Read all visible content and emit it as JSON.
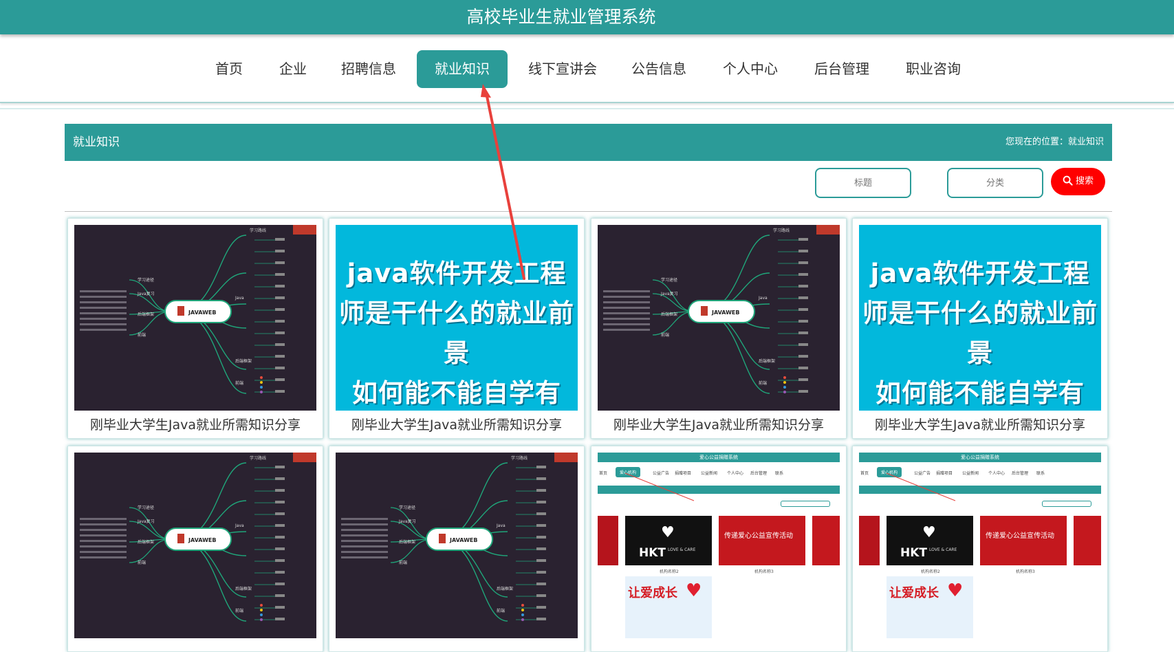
{
  "app": {
    "title": "高校毕业生就业管理系统"
  },
  "nav": {
    "items": [
      {
        "label": "首页"
      },
      {
        "label": "企业"
      },
      {
        "label": "招聘信息"
      },
      {
        "label": "就业知识",
        "active": true
      },
      {
        "label": "线下宣讲会"
      },
      {
        "label": "公告信息"
      },
      {
        "label": "个人中心"
      },
      {
        "label": "后台管理"
      },
      {
        "label": "职业咨询"
      }
    ]
  },
  "section": {
    "title": "就业知识",
    "breadcrumb": "您现在的位置：就业知识"
  },
  "filters": {
    "title_placeholder": "标题",
    "category_placeholder": "分类",
    "search_label": "搜索",
    "search_icon": "search-icon"
  },
  "colors": {
    "primary": "#2b9b98",
    "search": "#ff0000",
    "annotation_arrow": "#e8413c"
  },
  "cards": [
    {
      "title": "刚毕业大学生Java就业所需知识分享",
      "thumb": "mindmap"
    },
    {
      "title": "刚毕业大学生Java就业所需知识分享",
      "thumb": "java-text"
    },
    {
      "title": "刚毕业大学生Java就业所需知识分享",
      "thumb": "mindmap"
    },
    {
      "title": "刚毕业大学生Java就业所需知识分享",
      "thumb": "java-text"
    },
    {
      "title": "",
      "thumb": "mindmap"
    },
    {
      "title": "",
      "thumb": "mindmap"
    },
    {
      "title": "",
      "thumb": "charity"
    },
    {
      "title": "",
      "thumb": "charity"
    }
  ],
  "thumbs": {
    "java_text": [
      "java软件开发工程",
      "师是干什么的就业前景",
      "如何能不能自学有什..."
    ],
    "mindmap": {
      "center": "JAVAWEB",
      "badge_top": "学习路线",
      "left_nodes": [
        "学习途径",
        "Java复习",
        "后端框架",
        "前端"
      ],
      "right_nodes": [
        "Java",
        "后端框架",
        "前端"
      ]
    },
    "charity": {
      "header": "爱心公益捐赠系统",
      "nav": [
        "首页",
        "爱心机构",
        "公益广告",
        "捐赠项目",
        "公益新闻",
        "个人中心",
        "后台管理",
        "联系"
      ],
      "hkt_logo": "HKT",
      "hkt_sub": "LOVE & CARE",
      "red_title": "传递爱心公益宣传活动",
      "cap1": "机构名称2",
      "cap2": "机构名称3",
      "love_title": "让爱成长"
    }
  }
}
